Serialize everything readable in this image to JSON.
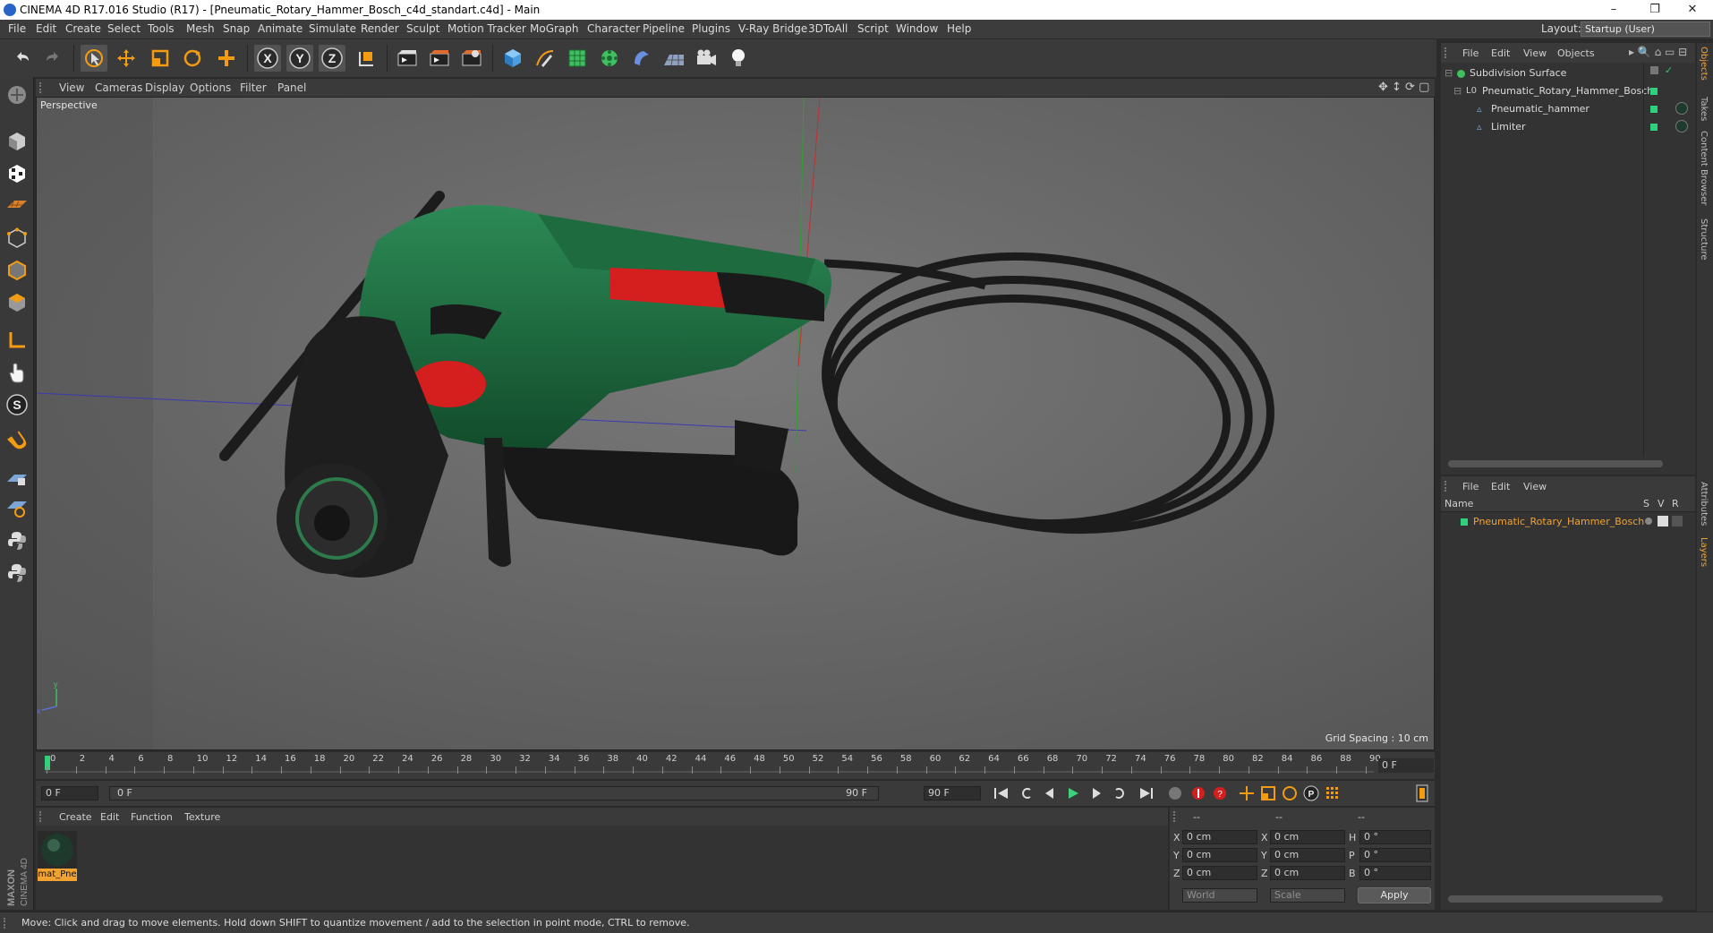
{
  "window": {
    "title": "CINEMA 4D R17.016 Studio (R17) - [Pneumatic_Rotary_Hammer_Bosch_c4d_standart.c4d] - Main",
    "controls": [
      "–",
      "❐",
      "✕"
    ]
  },
  "menubar": {
    "items": [
      "File",
      "Edit",
      "Create",
      "Select",
      "Tools",
      "Mesh",
      "Snap",
      "Animate",
      "Simulate",
      "Render",
      "Sculpt",
      "Motion Tracker",
      "MoGraph",
      "Character",
      "Pipeline",
      "Plugins",
      "V-Ray Bridge",
      "3DToAll",
      "Script",
      "Window",
      "Help"
    ],
    "layout_label": "Layout:",
    "layout_value": "Startup (User)"
  },
  "toolbar": {
    "icons": [
      "undo-icon",
      "redo-icon",
      "live-selection-icon",
      "move-icon",
      "scale-icon",
      "rotate-icon",
      "move-plus-icon",
      "x-axis-icon",
      "y-axis-icon",
      "z-axis-icon",
      "coordinate-system-icon",
      "render-view-icon",
      "render-picture-viewer-icon",
      "edit-render-settings-icon",
      "cube-icon",
      "spline-pen-icon",
      "subdivision-surface-icon",
      "cloner-icon",
      "deformer-icon",
      "floor-icon",
      "camera-icon",
      "light-icon"
    ],
    "axis_labels": [
      "X",
      "Y",
      "Z"
    ]
  },
  "viewport": {
    "menu": [
      "View",
      "Cameras",
      "Display",
      "Options",
      "Filter",
      "Panel"
    ],
    "label": "Perspective",
    "grid_spacing": "Grid Spacing : 10 cm",
    "gizmo_y": "y",
    "gizmo_x": "x"
  },
  "timeline": {
    "ticks": [
      "0",
      "2",
      "4",
      "6",
      "8",
      "10",
      "12",
      "14",
      "16",
      "18",
      "20",
      "22",
      "24",
      "26",
      "28",
      "30",
      "32",
      "34",
      "36",
      "38",
      "40",
      "42",
      "44",
      "46",
      "48",
      "50",
      "52",
      "54",
      "56",
      "58",
      "60",
      "62",
      "64",
      "66",
      "68",
      "70",
      "72",
      "74",
      "76",
      "78",
      "80",
      "82",
      "84",
      "86",
      "88",
      "90"
    ],
    "current_frame": "0 F"
  },
  "transport": {
    "start_field": "0 F",
    "range_start": "0 F",
    "range_end": "90 F",
    "end_field": "90 F"
  },
  "material_manager": {
    "menu": [
      "Create",
      "Edit",
      "Function",
      "Texture"
    ],
    "materials": [
      {
        "name": "mat_Pne"
      }
    ]
  },
  "coordinates": {
    "headers": [
      "--",
      "--",
      "--"
    ],
    "rows": [
      {
        "a_label": "X",
        "a_val": "0 cm",
        "b_label": "X",
        "b_val": "0 cm",
        "c_label": "H",
        "c_val": "0 °"
      },
      {
        "a_label": "Y",
        "a_val": "0 cm",
        "b_label": "Y",
        "b_val": "0 cm",
        "c_label": "P",
        "c_val": "0 °"
      },
      {
        "a_label": "Z",
        "a_val": "0 cm",
        "b_label": "Z",
        "b_val": "0 cm",
        "c_label": "B",
        "c_val": "0 °"
      }
    ],
    "mode_world": "World",
    "mode_scale": "Scale",
    "apply_label": "Apply"
  },
  "object_manager": {
    "menu": [
      "File",
      "Edit",
      "View",
      "Objects"
    ],
    "objects": [
      {
        "name": "Subdivision Surface",
        "indent": 0
      },
      {
        "name": "Pneumatic_Rotary_Hammer_Bosch",
        "indent": 1
      },
      {
        "name": "Pneumatic_hammer",
        "indent": 2
      },
      {
        "name": "Limiter",
        "indent": 2
      }
    ]
  },
  "attribute_manager": {
    "menu": [
      "File",
      "Edit",
      "View"
    ],
    "columns": [
      "Name",
      "S",
      "V",
      "R"
    ],
    "layers": [
      {
        "name": "Pneumatic_Rotary_Hammer_Bosch"
      }
    ]
  },
  "right_tabs": [
    "Objects",
    "Takes",
    "Content Browser",
    "Structure",
    "Attributes",
    "Layers"
  ],
  "status": {
    "text": "Move: Click and drag to move elements. Hold down SHIFT to quantize movement / add to the selection in point mode, CTRL to remove."
  },
  "brand": {
    "vertical_logo": "MAXON CINEMA 4D"
  },
  "colors": {
    "accent_green": "#2fd17a",
    "selection_orange": "#f2a230",
    "viewport_bg": "#606060",
    "panel_bg": "#333333"
  }
}
